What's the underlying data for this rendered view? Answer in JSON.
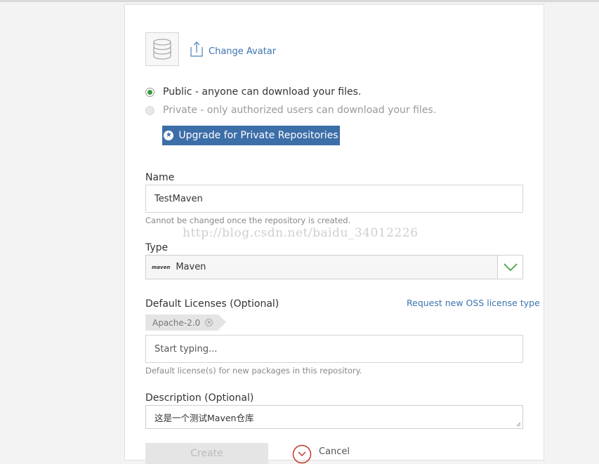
{
  "avatar": {
    "icon": "database-icon",
    "change_label": "Change Avatar"
  },
  "visibility": {
    "public_label": "Public - anyone can download your files.",
    "private_label": "Private - only authorized users can download your files.",
    "selected": "public",
    "upgrade_label": "Upgrade for Private Repositories"
  },
  "name_field": {
    "label": "Name",
    "value": "TestMaven",
    "hint": "Cannot be changed once the repository is created."
  },
  "watermark": "http://blog.csdn.net/baidu_34012226",
  "type_field": {
    "label": "Type",
    "logo_text": "maven",
    "value": "Maven"
  },
  "licenses": {
    "label": "Default Licenses (Optional)",
    "request_link": "Request new OSS license type",
    "tag": "Apache-2.0",
    "input_placeholder": "Start typing...",
    "hint": "Default license(s) for new packages in this repository."
  },
  "description": {
    "label": "Description (Optional)",
    "value": "这是一个测试Maven仓库"
  },
  "actions": {
    "create_label": "Create",
    "cancel_label": "Cancel"
  },
  "colors": {
    "accent": "#3c6ea8",
    "link": "#3b73b0",
    "radio_selected": "#3a9a3a",
    "cancel": "#c0392b"
  }
}
